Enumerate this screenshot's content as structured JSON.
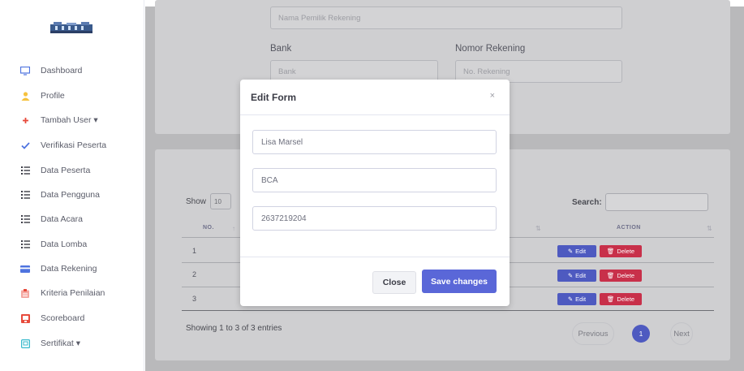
{
  "sidebar": {
    "items": [
      {
        "label": "Dashboard",
        "icon": "monitor-icon",
        "color": "#4e73df"
      },
      {
        "label": "Profile",
        "icon": "user-icon",
        "color": "#f6c23e"
      },
      {
        "label": "Tambah User ▾",
        "icon": "plus-icon",
        "color": "#e74a3b"
      },
      {
        "label": "Verifikasi Peserta",
        "icon": "check-icon",
        "color": "#4e73df"
      },
      {
        "label": "Data Peserta",
        "icon": "list-icon",
        "color": "#3a3b45"
      },
      {
        "label": "Data Pengguna",
        "icon": "list-icon",
        "color": "#3a3b45"
      },
      {
        "label": "Data Acara",
        "icon": "list-icon",
        "color": "#3a3b45"
      },
      {
        "label": "Data Lomba",
        "icon": "list-icon",
        "color": "#3a3b45"
      },
      {
        "label": "Data Rekening",
        "icon": "credit-card-icon",
        "color": "#4e73df"
      },
      {
        "label": "Kriteria Penilaian",
        "icon": "clipboard-icon",
        "color": "#e74a3b"
      },
      {
        "label": "Scoreboard",
        "icon": "scoreboard-icon",
        "color": "#e74a3b"
      },
      {
        "label": "Sertifikat ▾",
        "icon": "certificate-icon",
        "color": "#36b9cc"
      }
    ]
  },
  "background_form": {
    "owner_placeholder": "Nama Pemilik Rekening",
    "bank_label": "Bank",
    "bank_placeholder": "Bank",
    "account_label": "Nomor Rekening",
    "account_placeholder": "No. Rekening"
  },
  "table": {
    "show_label": "Show",
    "show_value": "10",
    "search_label": "Search:",
    "headers": {
      "no": "NO.",
      "action": "ACTION"
    },
    "rows": [
      {
        "no": "1",
        "edit": "Edit",
        "delete": "Delete"
      },
      {
        "no": "2",
        "edit": "Edit",
        "delete": "Delete"
      },
      {
        "no": "3",
        "edit": "Edit",
        "delete": "Delete"
      }
    ],
    "entries_info": "Showing 1 to 3 of 3 entries",
    "pagination": {
      "previous": "Previous",
      "current": "1",
      "next": "Next"
    }
  },
  "modal": {
    "title": "Edit Form",
    "close_icon": "×",
    "fields": {
      "name": "Lisa Marsel",
      "bank": "BCA",
      "account": "2637219204"
    },
    "close_label": "Close",
    "save_label": "Save changes"
  },
  "colors": {
    "primary": "#5a67d8",
    "danger": "#c8304a"
  }
}
